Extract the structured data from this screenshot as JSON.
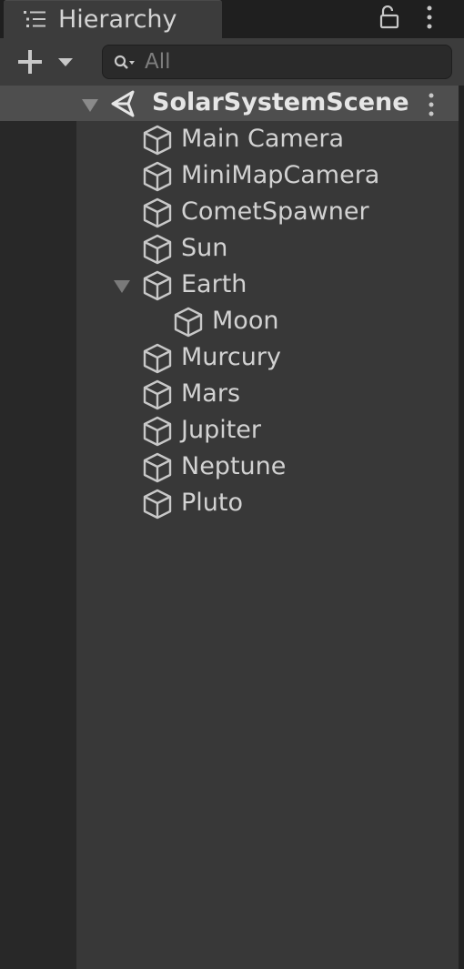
{
  "window": {
    "tab_title": "Hierarchy",
    "tab_icon": "hierarchy-list-icon",
    "lock_icon": "lock-icon",
    "menu_icon": "kebab-menu-icon"
  },
  "toolbar": {
    "add_icon": "plus-dropdown-icon",
    "search": {
      "icon": "search-icon",
      "value": "",
      "placeholder": "All"
    }
  },
  "scene": {
    "name": "SolarSystemScene",
    "icon": "unity-scene-icon",
    "expanded": true
  },
  "items": [
    {
      "label": "Main Camera",
      "depth": 1,
      "icon": "gameobject-cube-icon"
    },
    {
      "label": "MiniMapCamera",
      "depth": 1,
      "icon": "gameobject-cube-icon"
    },
    {
      "label": "CometSpawner",
      "depth": 1,
      "icon": "gameobject-cube-icon"
    },
    {
      "label": "Sun",
      "depth": 1,
      "icon": "gameobject-cube-icon"
    },
    {
      "label": "Earth",
      "depth": 1,
      "icon": "gameobject-cube-icon",
      "expanded": true
    },
    {
      "label": "Moon",
      "depth": 2,
      "icon": "gameobject-cube-icon"
    },
    {
      "label": "Murcury",
      "depth": 1,
      "icon": "gameobject-cube-icon"
    },
    {
      "label": "Mars",
      "depth": 1,
      "icon": "gameobject-cube-icon"
    },
    {
      "label": "Jupiter",
      "depth": 1,
      "icon": "gameobject-cube-icon"
    },
    {
      "label": "Neptune",
      "depth": 1,
      "icon": "gameobject-cube-icon"
    },
    {
      "label": "Pluto",
      "depth": 1,
      "icon": "gameobject-cube-icon"
    }
  ],
  "colors": {
    "panel_bg": "#383838",
    "toolbar_bg": "#3c3c3c",
    "selected_row": "#4e4e4e",
    "text": "#d2d2d2",
    "icon": "#c8c8c8"
  }
}
